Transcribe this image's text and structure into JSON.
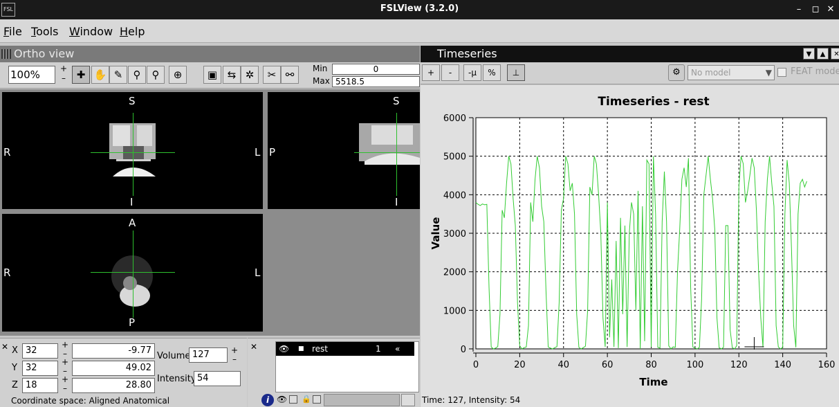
{
  "window": {
    "title": "FSLView (3.2.0)",
    "app_icon_text": "FSL",
    "minimize": "–",
    "maximize": "◻",
    "close": "✕"
  },
  "menubar": {
    "items": [
      {
        "label": "File",
        "u": "F",
        "rest": "ile"
      },
      {
        "label": "Tools",
        "u": "T",
        "rest": "ools"
      },
      {
        "label": "Window",
        "u": "W",
        "rest": "indow"
      },
      {
        "label": "Help",
        "u": "H",
        "rest": "elp"
      }
    ]
  },
  "ortho": {
    "title": "Ortho view",
    "zoom": "100%",
    "min_label": "Min",
    "min_value": "0",
    "max_label": "Max",
    "max_value": "5518.5",
    "tools": [
      "cross-tool-icon",
      "hand-icon",
      "pencil-icon",
      "zoom-icon",
      "zoom-out-icon",
      "target-icon"
    ],
    "views": {
      "coronal": {
        "top": "S",
        "bottom": "I",
        "left": "R",
        "right": "L"
      },
      "sagittal": {
        "top": "S",
        "bottom": "I",
        "left": "P",
        "right": ""
      },
      "axial": {
        "top": "A",
        "bottom": "P",
        "left": "R",
        "right": "L"
      }
    }
  },
  "coords": {
    "x_label": "X",
    "x_value": "32",
    "x_world": "-9.77",
    "y_label": "Y",
    "y_value": "32",
    "y_world": "49.02",
    "z_label": "Z",
    "z_value": "18",
    "z_world": "28.80",
    "volume_label": "Volume",
    "volume_value": "127",
    "intensity_label": "Intensity",
    "intensity_value": "54",
    "space_text": "Coordinate space: Aligned Anatomical"
  },
  "layers": {
    "items": [
      {
        "name": "rest",
        "number": "1",
        "arrow": "«"
      }
    ]
  },
  "timeseries": {
    "title": "Timeseries",
    "buttons": {
      "plus": "+",
      "minus": "-",
      "demean": "-µ",
      "percent": "%"
    },
    "model_select": "No model",
    "feat_label": "FEAT mode",
    "status": "Time: 127, Intensity: 54"
  },
  "chart_data": {
    "type": "line",
    "title": "Timeseries - rest",
    "xlabel": "Time",
    "ylabel": "Value",
    "xlim": [
      0,
      160
    ],
    "ylim": [
      0,
      6000
    ],
    "xticks": [
      0,
      20,
      40,
      60,
      80,
      100,
      120,
      140,
      160
    ],
    "yticks": [
      0,
      1000,
      2000,
      3000,
      4000,
      5000,
      6000
    ],
    "grid": true,
    "line_color": "#33cc33",
    "cursor": {
      "x": 127,
      "y": 54
    },
    "series": [
      {
        "values": [
          3800,
          3750,
          3720,
          3760,
          3740,
          3750,
          1600,
          50,
          0,
          20,
          60,
          900,
          3600,
          3400,
          4300,
          5000,
          4800,
          3900,
          3200,
          1200,
          80,
          0,
          30,
          50,
          600,
          3800,
          3300,
          4400,
          5000,
          4700,
          3700,
          3300,
          1500,
          50,
          20,
          0,
          30,
          60,
          1200,
          3600,
          3900,
          5000,
          4800,
          4100,
          4300,
          3500,
          900,
          40,
          0,
          30,
          70,
          1000,
          4200,
          4000,
          5000,
          4800,
          4000,
          3000,
          800,
          50,
          3800,
          300,
          1800,
          50,
          2800,
          20,
          3400,
          900,
          3200,
          50,
          3000,
          3800,
          3500,
          1000,
          4100,
          0,
          3700,
          200,
          4900,
          4800,
          50,
          5000,
          3500,
          40,
          20,
          3300,
          4600,
          3300,
          80,
          0,
          50,
          40,
          2000,
          3100,
          4400,
          4700,
          4200,
          4950,
          1600,
          50,
          20,
          0,
          40,
          1300,
          4000,
          4500,
          5000,
          4400,
          3900,
          3100,
          800,
          30,
          0,
          40,
          3200,
          3200,
          500,
          30,
          0,
          80,
          4200,
          5000,
          4800,
          3800,
          4100,
          4500,
          4950,
          4700,
          3600,
          2000,
          800,
          40,
          3300,
          4400,
          5000,
          4300,
          3700,
          600,
          50,
          0,
          40,
          3500,
          4900,
          4300,
          2600,
          600,
          40,
          3500,
          4300,
          4400,
          4200,
          4350
        ]
      }
    ]
  }
}
